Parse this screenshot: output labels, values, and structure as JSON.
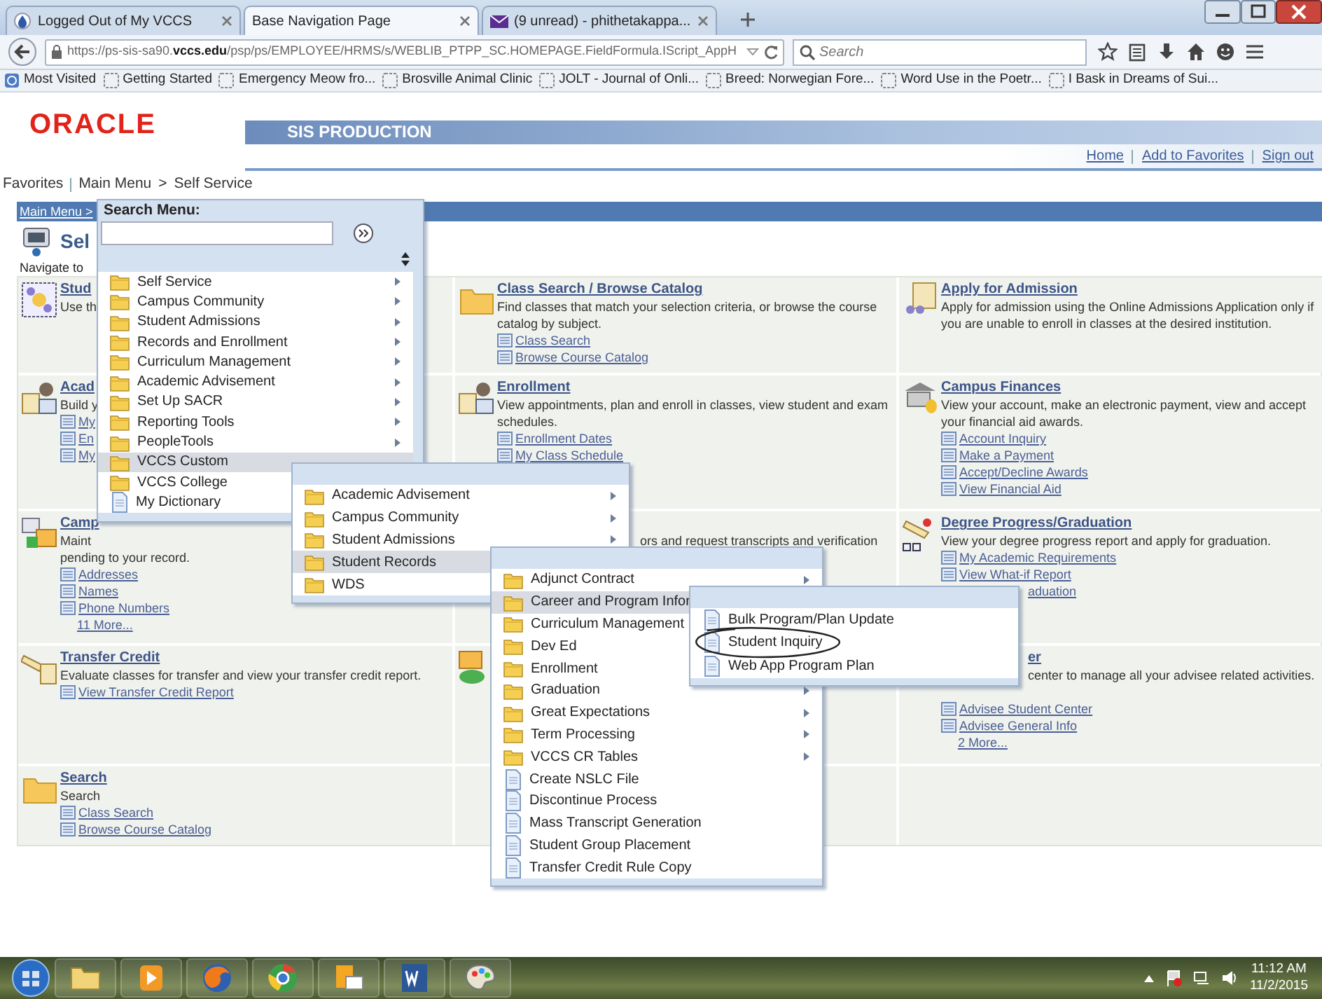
{
  "browser": {
    "tabs": [
      {
        "label": "Logged Out of My VCCS",
        "selected": false
      },
      {
        "label": "Base Navigation Page",
        "selected": true
      },
      {
        "label": "(9 unread) - phithetakappa...",
        "selected": false
      }
    ],
    "url": "https://ps-sis-sa90.**vccs.edu**/psp/ps/EMPLOYEE/HRMS/s/WEBLIB_PTPP_SC.HOMEPAGE.FieldFormula.IScript_AppH",
    "search": {
      "placeholder": "Search"
    },
    "bookmarks": [
      "Most Visited",
      "Getting Started",
      "Emergency Meow fro...",
      "Brosville Animal Clinic",
      "JOLT - Journal of Onli...",
      "Breed: Norwegian Fore...",
      "Word Use in the Poetr...",
      "I Bask in Dreams of Sui..."
    ]
  },
  "app": {
    "logo": "ORACLE",
    "environment": "SIS PRODUCTION",
    "header_links": [
      "Home",
      "Add to Favorites",
      "Sign out"
    ],
    "breadcrumb": [
      "Favorites",
      "Main Menu",
      "Self Service"
    ],
    "breadcrumb_separator": ">",
    "page": {
      "path": "Main Menu >",
      "title": "Sel",
      "intro": "Navigate to"
    },
    "tiles": [
      [
        {
          "kind": "full",
          "title": "Stud",
          "description": "Use th"
        },
        {
          "kind": "full",
          "title": "Class Search / Browse Catalog",
          "description": "Find classes that match your selection criteria, or browse the course catalog by subject.",
          "links": [
            {
              "label": "Class Search",
              "kind": "link"
            },
            {
              "label": "Browse Course Catalog",
              "kind": "link"
            }
          ]
        },
        {
          "kind": "full",
          "title": "Apply for Admission",
          "description": "Apply for admission using the Online Admissions Application only if you are unable to enroll in classes at the desired institution."
        }
      ],
      [
        {
          "kind": "full",
          "title": "Acad",
          "description": "Build y",
          "links": [
            {
              "label": "My",
              "kind": "link"
            },
            {
              "label": "En",
              "kind": "link"
            },
            {
              "label": "My",
              "kind": "link"
            }
          ]
        },
        {
          "kind": "full",
          "title": "Enrollment",
          "description": "View appointments, plan and enroll in classes, view student and exam schedules.",
          "links": [
            {
              "label": "Enrollment Dates",
              "kind": "link"
            },
            {
              "label": "My Class Schedule",
              "kind": "link"
            }
          ]
        },
        {
          "kind": "full",
          "title": "Campus Finances",
          "description": "View your account, make an electronic payment, view and accept your financial aid awards.",
          "links": [
            {
              "label": "Account Inquiry",
              "kind": "link"
            },
            {
              "label": "Make a Payment",
              "kind": "link"
            },
            {
              "label": "Accept/Decline Awards",
              "kind": "link"
            },
            {
              "label": "View Financial Aid",
              "kind": "link"
            }
          ]
        }
      ],
      [
        {
          "kind": "full",
          "title": "Camp",
          "description": "Maint",
          "description_2": "pending to your record.",
          "links": [
            {
              "label": "Addresses",
              "kind": "link"
            },
            {
              "label": "Names",
              "kind": "link"
            },
            {
              "label": "Phone Numbers",
              "kind": "link"
            }
          ],
          "more": "11 More..."
        },
        {
          "kind": "covered",
          "description": "ors and request transcripts and verification"
        },
        {
          "kind": "full",
          "title": "Degree Progress/Graduation",
          "description": "View your degree progress report and apply for graduation.",
          "links": [
            {
              "label": "My Academic Requirements",
              "kind": "link"
            },
            {
              "label": "View What-if Report",
              "kind": "link"
            },
            {
              "label": "aduation",
              "kind": "fragment"
            }
          ]
        }
      ],
      [
        {
          "kind": "full",
          "title": "Transfer Credit",
          "description": "Evaluate classes for transfer and view your transfer credit report.",
          "links": [
            {
              "label": "View Transfer Credit Report",
              "kind": "link"
            }
          ]
        },
        {
          "kind": "icon_only"
        },
        {
          "kind": "covered",
          "title": "er",
          "description": "center to manage all your advisee related activities.",
          "links": [
            {
              "label": "Advisee Student Center",
              "kind": "link"
            },
            {
              "label": "Advisee General Info",
              "kind": "link"
            }
          ],
          "more": "2 More..."
        }
      ],
      [
        {
          "kind": "full",
          "title": "Search",
          "description": "Search",
          "links": [
            {
              "label": "Class Search",
              "kind": "link"
            },
            {
              "label": "Browse Course Catalog",
              "kind": "link"
            }
          ]
        },
        {
          "kind": "empty"
        },
        {
          "kind": "empty"
        }
      ]
    ]
  },
  "menus": [
    {
      "kind": "search_menu",
      "heading": "Search Menu:",
      "items": [
        {
          "label": "Self Service",
          "kind": "folder",
          "submenu": true,
          "selected": false
        },
        {
          "label": "Campus Community",
          "kind": "folder",
          "submenu": true,
          "selected": false
        },
        {
          "label": "Student Admissions",
          "kind": "folder",
          "submenu": true,
          "selected": false
        },
        {
          "label": "Records and Enrollment",
          "kind": "folder",
          "submenu": true,
          "selected": false
        },
        {
          "label": "Curriculum Management",
          "kind": "folder",
          "submenu": true,
          "selected": false
        },
        {
          "label": "Academic Advisement",
          "kind": "folder",
          "submenu": true,
          "selected": false
        },
        {
          "label": "Set Up SACR",
          "kind": "folder",
          "submenu": true,
          "selected": false
        },
        {
          "label": "Reporting Tools",
          "kind": "folder",
          "submenu": true,
          "selected": false
        },
        {
          "label": "PeopleTools",
          "kind": "folder",
          "submenu": true,
          "selected": false
        },
        {
          "label": "VCCS Custom",
          "kind": "folder",
          "submenu": false,
          "selected": true
        },
        {
          "label": "VCCS College",
          "kind": "folder",
          "submenu": false,
          "selected": false
        },
        {
          "label": "My Dictionary",
          "kind": "document",
          "submenu": false,
          "selected": false
        }
      ]
    },
    {
      "kind": "submenu",
      "items": [
        {
          "label": "Academic Advisement",
          "kind": "folder",
          "submenu": true,
          "selected": false
        },
        {
          "label": "Campus Community",
          "kind": "folder",
          "submenu": true,
          "selected": false
        },
        {
          "label": "Student Admissions",
          "kind": "folder",
          "submenu": true,
          "selected": false
        },
        {
          "label": "Student Records",
          "kind": "folder",
          "submenu": false,
          "selected": true
        },
        {
          "label": "WDS",
          "kind": "folder",
          "submenu": false,
          "selected": false
        }
      ]
    },
    {
      "kind": "submenu",
      "items": [
        {
          "label": "Adjunct Contract",
          "kind": "folder",
          "submenu": true,
          "selected": false
        },
        {
          "label": "Career and Program Infor",
          "kind": "folder",
          "submenu": false,
          "selected": true
        },
        {
          "label": "Curriculum Management",
          "kind": "folder",
          "submenu": false,
          "selected": false
        },
        {
          "label": "Dev Ed",
          "kind": "folder",
          "submenu": false,
          "selected": false
        },
        {
          "label": "Enrollment",
          "kind": "folder",
          "submenu": false,
          "selected": false
        },
        {
          "label": "Graduation",
          "kind": "folder",
          "submenu": true,
          "selected": false
        },
        {
          "label": "Great Expectations",
          "kind": "folder",
          "submenu": true,
          "selected": false
        },
        {
          "label": "Term Processing",
          "kind": "folder",
          "submenu": true,
          "selected": false
        },
        {
          "label": "VCCS CR Tables",
          "kind": "folder",
          "submenu": true,
          "selected": false
        },
        {
          "label": "Create NSLC File",
          "kind": "document",
          "submenu": false,
          "selected": false
        },
        {
          "label": "Discontinue Process",
          "kind": "document",
          "submenu": false,
          "selected": false
        },
        {
          "label": "Mass Transcript Generation",
          "kind": "document",
          "submenu": false,
          "selected": false
        },
        {
          "label": "Student Group Placement",
          "kind": "document",
          "submenu": false,
          "selected": false
        },
        {
          "label": "Transfer Credit Rule Copy",
          "kind": "document",
          "submenu": false,
          "selected": false
        }
      ]
    },
    {
      "kind": "submenu",
      "items": [
        {
          "label": "Bulk Program/Plan Update",
          "kind": "document",
          "submenu": false,
          "selected": false,
          "circled": false
        },
        {
          "label": "Student Inquiry",
          "kind": "document",
          "submenu": false,
          "selected": false,
          "circled": true
        },
        {
          "label": "Web App Program Plan",
          "kind": "document",
          "submenu": false,
          "selected": false,
          "circled": false
        }
      ]
    }
  ],
  "taskbar": {
    "time": "11:12 AM",
    "date": "11/2/2015"
  }
}
